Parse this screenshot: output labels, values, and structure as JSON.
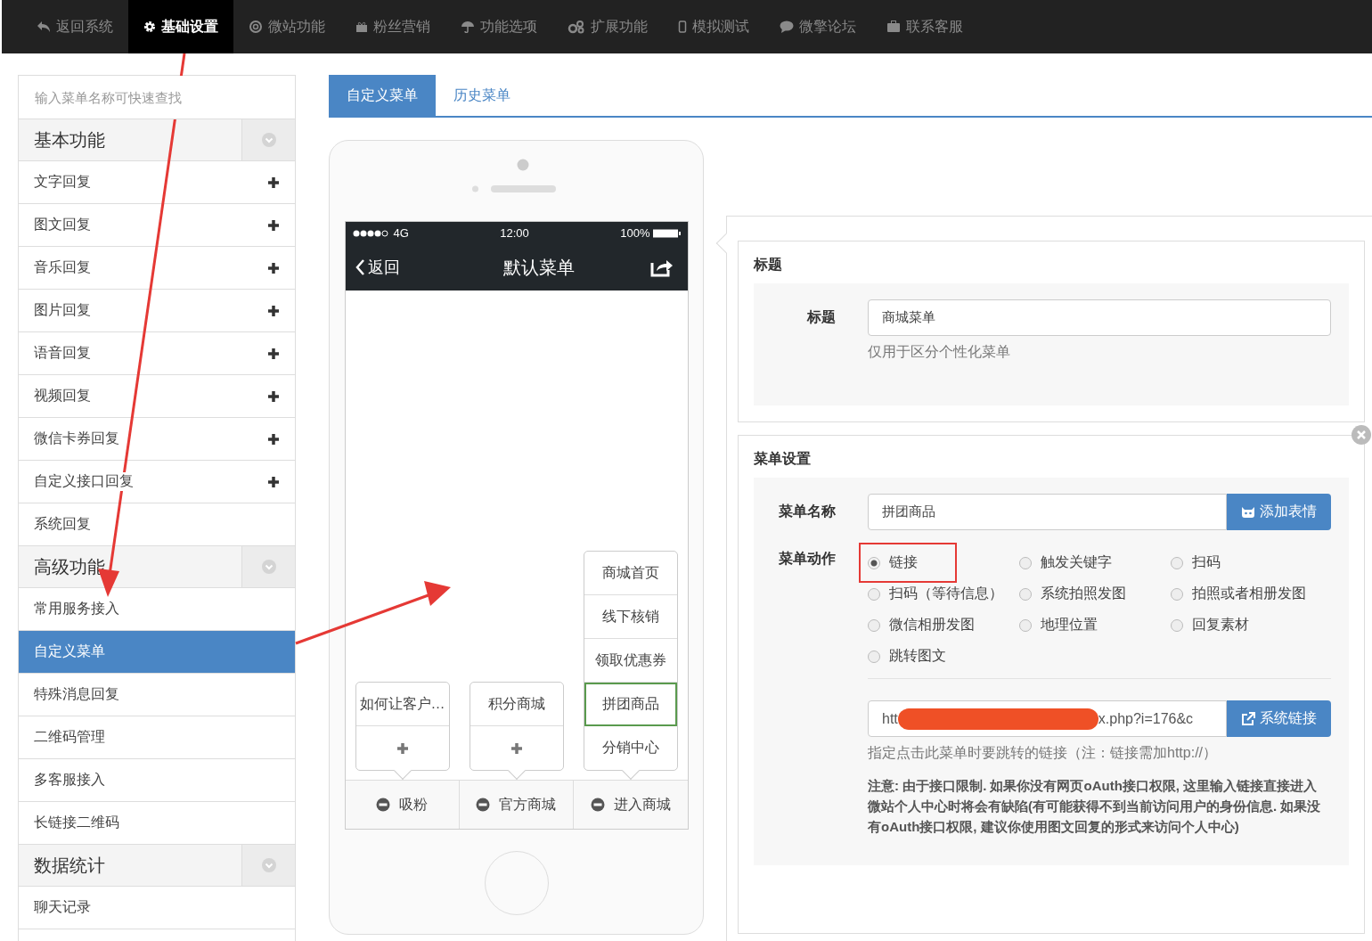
{
  "nav": [
    {
      "label": "返回系统",
      "selected": false
    },
    {
      "label": "基础设置",
      "selected": true
    },
    {
      "label": "微站功能",
      "selected": false
    },
    {
      "label": "粉丝营销",
      "selected": false
    },
    {
      "label": "功能选项",
      "selected": false
    },
    {
      "label": "扩展功能",
      "selected": false
    },
    {
      "label": "模拟测试",
      "selected": false
    },
    {
      "label": "微擎论坛",
      "selected": false
    },
    {
      "label": "联系客服",
      "selected": false
    }
  ],
  "sidebar": {
    "search": {
      "placeholder": "输入菜单名称可快速查找"
    },
    "groups": [
      {
        "title": "基本功能",
        "items": [
          {
            "label": "文字回复",
            "selected": false,
            "addable": true
          },
          {
            "label": "图文回复",
            "selected": false,
            "addable": true
          },
          {
            "label": "音乐回复",
            "selected": false,
            "addable": true
          },
          {
            "label": "图片回复",
            "selected": false,
            "addable": true
          },
          {
            "label": "语音回复",
            "selected": false,
            "addable": true
          },
          {
            "label": "视频回复",
            "selected": false,
            "addable": true
          },
          {
            "label": "微信卡券回复",
            "selected": false,
            "addable": true
          },
          {
            "label": "自定义接口回复",
            "selected": false,
            "addable": true
          },
          {
            "label": "系统回复",
            "selected": false,
            "addable": false
          }
        ]
      },
      {
        "title": "高级功能",
        "items": [
          {
            "label": "常用服务接入",
            "selected": false,
            "addable": false
          },
          {
            "label": "自定义菜单",
            "selected": true,
            "addable": false
          },
          {
            "label": "特殊消息回复",
            "selected": false,
            "addable": false
          },
          {
            "label": "二维码管理",
            "selected": false,
            "addable": false
          },
          {
            "label": "多客服接入",
            "selected": false,
            "addable": false
          },
          {
            "label": "长链接二维码",
            "selected": false,
            "addable": false
          }
        ]
      },
      {
        "title": "数据统计",
        "items": [
          {
            "label": "聊天记录",
            "selected": false,
            "addable": false
          }
        ]
      }
    ]
  },
  "tabs": [
    {
      "label": "自定义菜单",
      "selected": true
    },
    {
      "label": "历史菜单",
      "selected": false
    }
  ],
  "phone": {
    "carrier": "4G",
    "time": "12:00",
    "battery": "100%",
    "back": "返回",
    "title": "默认菜单",
    "menus": [
      {
        "label": "吸粉",
        "children": [
          {
            "kind": "item",
            "label": "如何让客户…",
            "selected": false
          },
          {
            "kind": "add"
          }
        ]
      },
      {
        "label": "官方商城",
        "children": [
          {
            "kind": "item",
            "label": "积分商城",
            "selected": false
          },
          {
            "kind": "add"
          }
        ]
      },
      {
        "label": "进入商城",
        "children": [
          {
            "kind": "item",
            "label": "商城首页",
            "selected": false
          },
          {
            "kind": "item",
            "label": "线下核销",
            "selected": false
          },
          {
            "kind": "item",
            "label": "领取优惠券",
            "selected": false
          },
          {
            "kind": "item",
            "label": "拼团商品",
            "selected": true
          },
          {
            "kind": "item",
            "label": "分销中心",
            "selected": false
          }
        ]
      }
    ]
  },
  "title_section": {
    "heading": "标题",
    "field_label": "标题",
    "value": "商城菜单",
    "help": "仅用于区分个性化菜单"
  },
  "menu_section": {
    "heading": "菜单设置",
    "name_label": "菜单名称",
    "name_value": "拼团商品",
    "emoji_button": "添加表情",
    "action_label": "菜单动作",
    "actions": [
      {
        "label": "链接",
        "selected": true,
        "highlighted": true
      },
      {
        "label": "触发关键字",
        "selected": false,
        "highlighted": false
      },
      {
        "label": "扫码",
        "selected": false,
        "highlighted": false
      },
      {
        "label": "扫码（等待信息）",
        "selected": false,
        "highlighted": false
      },
      {
        "label": "系统拍照发图",
        "selected": false,
        "highlighted": false
      },
      {
        "label": "拍照或者相册发图",
        "selected": false,
        "highlighted": false
      },
      {
        "label": "微信相册发图",
        "selected": false,
        "highlighted": false
      },
      {
        "label": "地理位置",
        "selected": false,
        "highlighted": false
      },
      {
        "label": "回复素材",
        "selected": false,
        "highlighted": false
      },
      {
        "label": "跳转图文",
        "selected": false,
        "highlighted": false
      }
    ],
    "url_start": "htt",
    "url_end": "x.php?i=176&c",
    "link_button": "系统链接",
    "link_help": "指定点击此菜单时要跳转的链接（注：链接需加http://）",
    "notice": "注意: 由于接口限制. 如果你没有网页oAuth接口权限, 这里输入链接直接进入微站个人中心时将会有缺陷(有可能获得不到当前访问用户的身份信息. 如果没有oAuth接口权限, 建议你使用图文回复的形式来访问个人中心)"
  }
}
